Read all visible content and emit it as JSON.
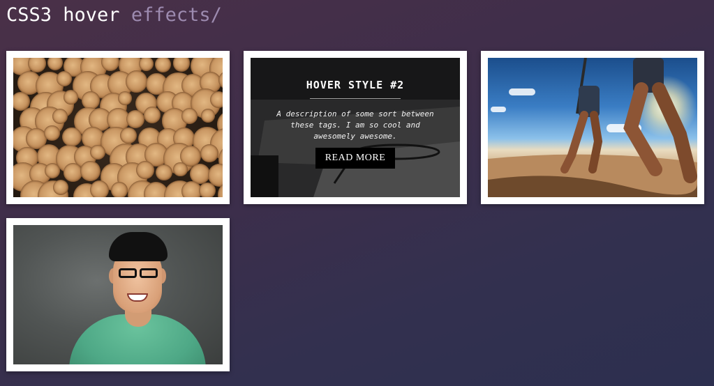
{
  "header": {
    "title_main": "CSS3 hover",
    "title_accent": "effects/"
  },
  "cards": [
    {
      "image": "stacked-wood-logs"
    },
    {
      "image": "desk-with-glasses",
      "hover_title": "HOVER STYLE #2",
      "hover_description": "A description of some sort between these tags. I am so cool and awesomely awesome.",
      "button_label": "READ MORE"
    },
    {
      "image": "people-walking-on-beach"
    },
    {
      "image": "smiling-man-with-glasses"
    }
  ],
  "colors": {
    "title": "#ffffff",
    "title_accent": "#9d8bb0",
    "button_bg": "#000000"
  }
}
